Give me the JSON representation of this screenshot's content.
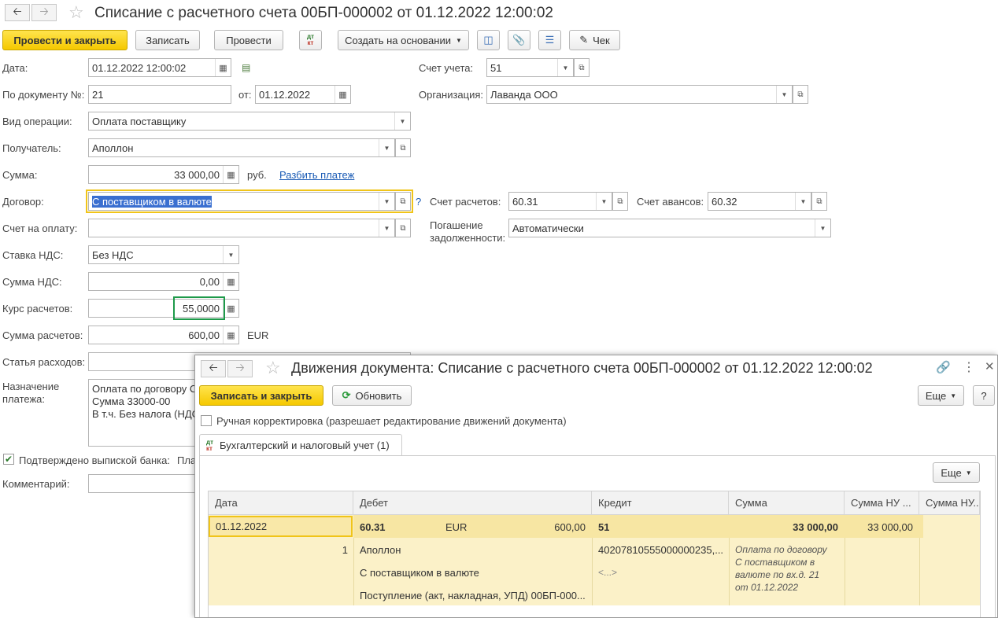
{
  "main": {
    "title": "Списание с расчетного счета 00БП-000002 от 01.12.2022 12:00:02",
    "toolbar": {
      "post_close": "Провести и закрыть",
      "save": "Записать",
      "post": "Провести",
      "dtkt": "Дт Кт",
      "create_based": "Создать на основании",
      "check": "Чек"
    },
    "form": {
      "date_label": "Дата:",
      "date_value": "01.12.2022 12:00:02",
      "docnum_label": "По документу №:",
      "docnum_value": "21",
      "from_label": "от:",
      "from_value": "01.12.2022",
      "account_label": "Счет учета:",
      "account_value": "51",
      "org_label": "Организация:",
      "org_value": "Лаванда ООО",
      "optype_label": "Вид операции:",
      "optype_value": "Оплата поставщику",
      "recipient_label": "Получатель:",
      "recipient_value": "Аполлон",
      "sum_label": "Сумма:",
      "sum_value": "33 000,00",
      "sum_currency": "руб.",
      "split_link": "Разбить платеж",
      "contract_label": "Договор:",
      "contract_value": "С поставщиком в валюте",
      "question": "?",
      "settle_account_label": "Счет расчетов:",
      "settle_account_value": "60.31",
      "advance_account_label": "Счет авансов:",
      "advance_account_value": "60.32",
      "invoice_label": "Счет на оплату:",
      "invoice_value": "",
      "repay_label_1": "Погашение",
      "repay_label_2": "задолженности:",
      "repay_value": "Автоматически",
      "vat_rate_label": "Ставка НДС:",
      "vat_rate_value": "Без НДС",
      "vat_sum_label": "Сумма НДС:",
      "vat_sum_value": "0,00",
      "rate_label": "Курс расчетов:",
      "rate_value": "55,0000",
      "settle_sum_label": "Сумма расчетов:",
      "settle_sum_value": "600,00",
      "settle_currency": "EUR",
      "expense_label": "Статья расходов:",
      "purpose_label_1": "Назначение",
      "purpose_label_2": "платежа:",
      "purpose_lines": [
        "Оплата по договору С",
        "Сумма 33000-00",
        "В т.ч. Без налога (НДС"
      ],
      "confirmed_label": "Подтверждено выпиской банка:",
      "confirmed_suffix": "Пла",
      "comment_label": "Комментарий:"
    }
  },
  "movements": {
    "title": "Движения документа: Списание с расчетного счета 00БП-000002 от 01.12.2022 12:00:02",
    "save_close": "Записать и закрыть",
    "refresh": "Обновить",
    "more": "Еще",
    "help": "?",
    "manual_label": "Ручная корректировка (разрешает редактирование движений документа)",
    "tab_label": "Бухгалтерский и налоговый учет (1)",
    "table_more": "Еще",
    "columns": [
      "Дата",
      "Дебет",
      "Кредит",
      "Сумма",
      "Сумма НУ ...",
      "Сумма НУ..."
    ],
    "row": {
      "date": "01.12.2022",
      "line_no": "1",
      "debit_account": "60.31",
      "debit_currency": "EUR",
      "debit_cur_sum": "600,00",
      "debit_sub1": "Аполлон",
      "debit_sub2": "С поставщиком в валюте",
      "debit_sub3": "Поступление (акт, накладная, УПД) 00БП-000...",
      "credit_account": "51",
      "credit_sub1": "40207810555000000235,...",
      "credit_sub2": "<...>",
      "sum": "33 000,00",
      "sum_nu": "33 000,00",
      "content": [
        "Оплата по договору",
        "С поставщиком в",
        "валюте по вх.д. 21",
        "от 01.12.2022"
      ]
    }
  }
}
